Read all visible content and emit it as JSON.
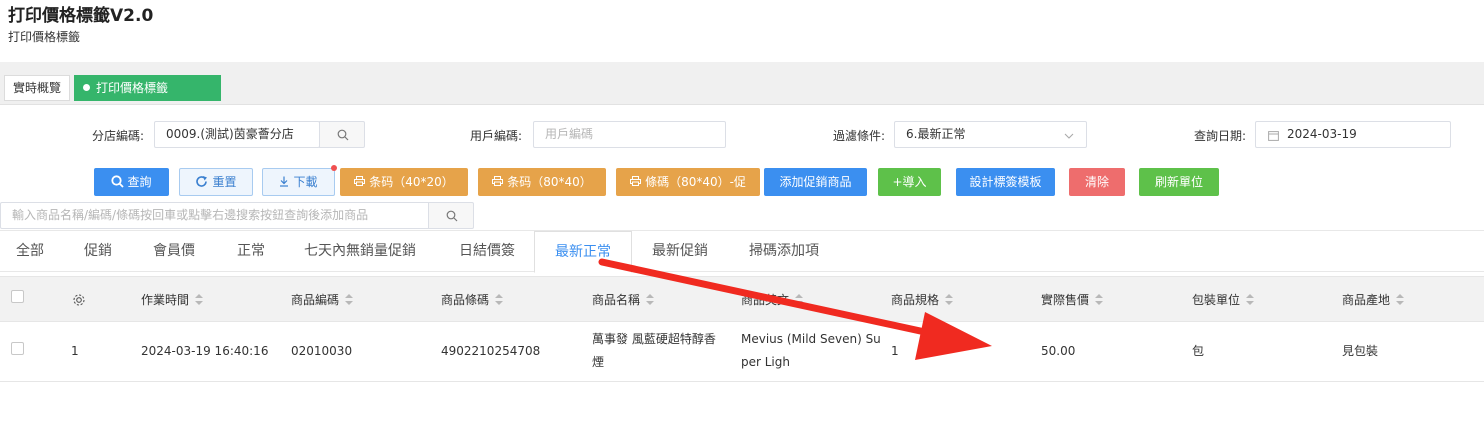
{
  "app": {
    "title": "打印價格標籤V2.0",
    "subtitle": "打印價格標籤"
  },
  "top_tabs": [
    {
      "label": "實時概覽"
    },
    {
      "label": "打印價格標籤V2.0",
      "close": "×"
    }
  ],
  "filters": {
    "shop_label": "分店編碼:",
    "shop_value": "0009.(測試)茵豪薈分店",
    "user_label": "用戶編碼:",
    "user_placeholder": "用戶編碼",
    "filter_label": "過濾條件:",
    "filter_value": "6.最新正常",
    "date_label": "查詢日期:",
    "date_value": "2024-03-19"
  },
  "toolbar": {
    "query": "查詢",
    "reset": "重置",
    "download": "下載",
    "print_40x20": "条码（40*20）",
    "print_80x40": "条码（80*40）",
    "print_80x40_promo": "條碼（80*40）-促",
    "add_promo": "添加促銷商品",
    "import": "+導入",
    "design": "設計標簽模板",
    "clear": "清除",
    "refresh_unit": "刷新單位"
  },
  "search": {
    "placeholder": "輸入商品名稱/編碼/條碼按回車或點擊右邊搜索按鈕查詢後添加商品"
  },
  "sub_tabs": [
    "全部",
    "促銷",
    "會員價",
    "正常",
    "七天內無銷量促銷",
    "日結價簽",
    "最新正常",
    "最新促銷",
    "掃碼添加項"
  ],
  "active_sub_tab": "最新正常",
  "table": {
    "headers": [
      "作業時間",
      "商品編碼",
      "商品條碼",
      "商品名稱",
      "商品英文",
      "商品規格",
      "實際售價",
      "包裝單位",
      "商品產地"
    ],
    "rows": [
      {
        "index": "1",
        "time": "2024-03-19 16:40:16",
        "code": "02010030",
        "barcode": "4902210254708",
        "name_line1": "萬事發 風藍硬超特醇香",
        "name_line2": "煙",
        "en_line1": "Mevius (Mild Seven) Su",
        "en_line2": "per Ligh",
        "spec": "1",
        "price": "50.00",
        "unit": "包",
        "origin": "見包裝"
      }
    ]
  },
  "colors": {
    "primary": "#3b8ff0",
    "active_tab": "#35b56b",
    "orange": "#e6a34a",
    "green": "#5ec14a",
    "red": "#ee6d6d",
    "arrow": "#f02a20"
  },
  "icons": [
    "search-icon",
    "refresh-icon",
    "download-icon",
    "printer-icon",
    "calendar-icon",
    "chevron-down-icon",
    "gear-icon"
  ]
}
